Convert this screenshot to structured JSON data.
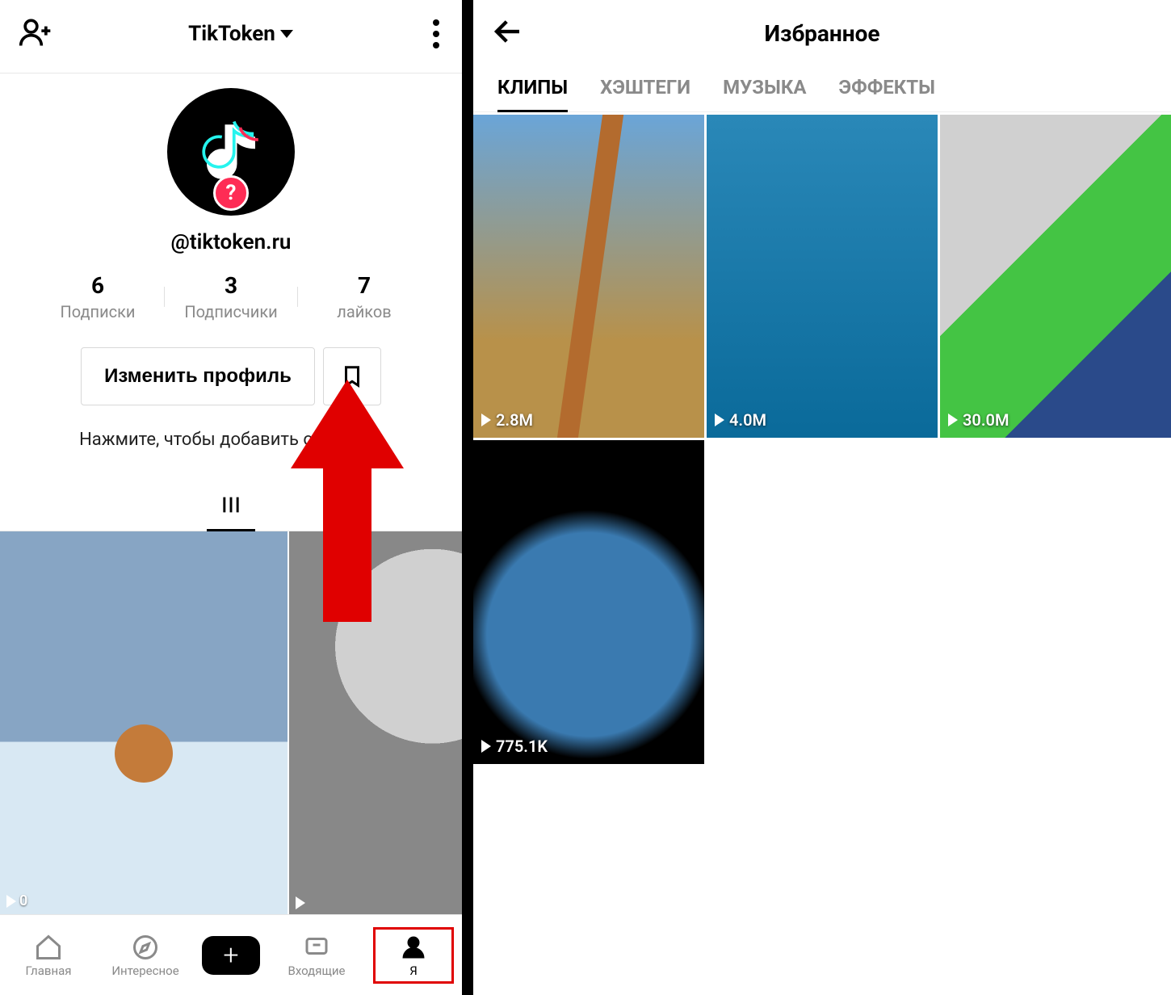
{
  "left": {
    "header": {
      "account_name": "TikToken"
    },
    "profile": {
      "username": "@tiktoken.ru",
      "avatar_badge": "?",
      "stats": [
        {
          "count": "6",
          "label": "Подписки"
        },
        {
          "count": "3",
          "label": "Подписчики"
        },
        {
          "count": "7",
          "label": "лайков"
        }
      ],
      "edit_button_label": "Изменить профиль",
      "add_bio_hint": "Нажмите, чтобы добавить описание"
    },
    "grid_thumbs": [
      {
        "views": "0"
      },
      {
        "views": ""
      }
    ],
    "bottom_nav": {
      "items": [
        {
          "label": "Главная"
        },
        {
          "label": "Интересное"
        },
        {
          "label": "Входящие"
        },
        {
          "label": "Я"
        }
      ]
    }
  },
  "right": {
    "title": "Избранное",
    "tabs": [
      {
        "label": "КЛИПЫ",
        "active": true
      },
      {
        "label": "ХЭШТЕГИ",
        "active": false
      },
      {
        "label": "МУЗЫКА",
        "active": false
      },
      {
        "label": "ЭФФЕКТЫ",
        "active": false
      }
    ],
    "clips": [
      {
        "views": "2.8M"
      },
      {
        "views": "4.0M"
      },
      {
        "views": "30.0M"
      },
      {
        "views": "775.1K"
      }
    ]
  },
  "colors": {
    "arrow": "#e00000",
    "accent_pink": "#fe2c55",
    "accent_cyan": "#25f4ee"
  }
}
